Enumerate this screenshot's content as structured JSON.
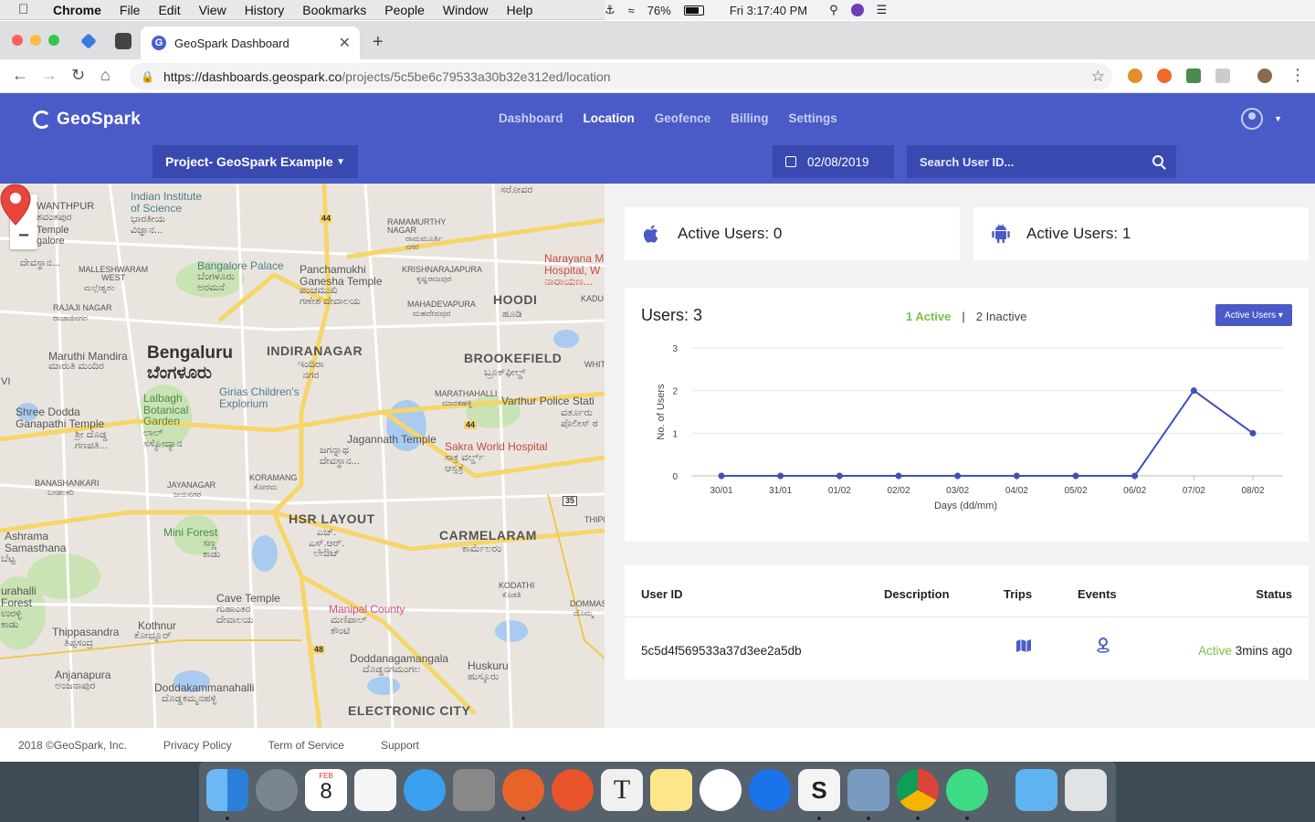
{
  "menubar": {
    "app": "Chrome",
    "items": [
      "File",
      "Edit",
      "View",
      "History",
      "Bookmarks",
      "People",
      "Window",
      "Help"
    ],
    "battery": "76%",
    "clock": "Fri 3:17:40 PM"
  },
  "browser": {
    "tab_title": "GeoSpark Dashboard",
    "url_host": "https://dashboards.geospark.co",
    "url_path": "/projects/5c5be6c79533a30b32e312ed/location"
  },
  "header": {
    "logo_text": "GeoSpark",
    "nav": [
      "Dashboard",
      "Location",
      "Geofence",
      "Billing",
      "Settings"
    ],
    "active_nav": "Location",
    "project_selector": "Project- GeoSpark Example",
    "date": "02/08/2019",
    "search_placeholder": "Search User ID..."
  },
  "map": {
    "labels": {
      "bengaluru": "Bengaluru",
      "bengaluru_kn": "ಬೆಂಗಳೂರು",
      "indiranagar": "INDIRANAGAR",
      "indiranagar_kn": "ಇಂದಿರಾ\nನಗರ",
      "brookefield": "BROOKEFIELD",
      "brookefield_kn": "ಬ್ರೂಕ್‌ಫೀಲ್ಡ್",
      "hoodi": "HOODI",
      "hoodi_kn": "ಹೂಡಿ",
      "hsr": "HSR LAYOUT",
      "hsr_kn": "ಎಚ್.\nಎಸ್.ಆರ್.\nಲೇಔಟ್",
      "carmelaram": "CARMELARAM",
      "carmelaram_kn": "ಕಾರ್ಮೆಲರಂ",
      "electronic_city": "ELECTRONIC CITY",
      "iisc": "Indian Institute\nof Science",
      "iisc_kn": "ಭಾರತೀಯ\nವಿಜ್ಞಾನ...",
      "palace": "Bangalore Palace",
      "palace_kn": "ಬೆಂಗಳೂರು\nಅರಮನೆ",
      "panchamukhi": "Panchamukhi\nGanesha Temple",
      "panchamukhi_kn": "ಪಂಚಮುಖಿ\nಗಣೇಶ ದೇವಾಲಯ",
      "ramamurthy": "RAMAMURTHY\nNAGAR",
      "ramamurthy_kn": "ರಾಮಮೂರ್ತಿ\nನಗರ",
      "krishnarajapura": "KRISHNARAJAPURA",
      "krishnarajapura_kn": "ಕೃಷ್ಣರಾಜಪುರ",
      "mahadevapura": "MAHADEVAPURA",
      "mahadevapura_kn": "ಮಹದೇವಪುರ",
      "narayana": "Narayana M\nHospital, W\nನಾರಾಯಣ...",
      "malleshwaram": "MALLESHWARAM\nWEST",
      "malleshwaram_kn": "ಮಲ್ಲೇಶ್ವರಂ",
      "rajaji": "RAJAJI NAGAR",
      "rajaji_kn": "ರಾಜಾಜಿನಗರ",
      "maruthi": "Maruthi Mandira",
      "maruthi_kn": "ಮಾರುತಿ ಮಂದಿರ",
      "girias": "Girias Children's\nExplorium",
      "lalbagh": "Lalbagh\nBotanical\nGarden",
      "lalbagh_kn": "ಲಾಲ್\nಸಸ್ಯೋದ್ಯಾನ",
      "shree": "Shree Dodda\nGanapathi Temple",
      "shree_kn": "ಶ್ರೀ ದೊಡ್ಡ\nಗಣಪತಿ...",
      "jagannath": "Jagannath Temple",
      "jagannath_kn": "ಜಗನ್ನಾಥ\nದೇವಸ್ಥಾನ...",
      "sakra": "Sakra World Hospital",
      "sakra_kn": "ಸಾಕ್ರ ವರ್ಲ್ಡ್\nಆಸ್ಪತ್ರೆ",
      "marathahalli": "MARATHAHALLI",
      "marathahalli_kn": "ಮಾರತಹಳ್ಳಿ",
      "varthur": "Varthur Police Stati",
      "varthur_kn": "ವರ್ತೂರು\nಪೊಲೀಸ್ ಠ",
      "banashankari": "BANASHANKARI",
      "banashankari_kn": "ಬನಶಂಕರಿ",
      "jayanagar": "JAYANAGAR",
      "jayanagar_kn": "ಜಯನಗರ",
      "koramangala": "KORAMANG",
      "koramangala_kn": "ಕೋರಮ",
      "mini_forest": "Mini Forest",
      "mini_forest_kn": "ಸಣ್ಣ\nಕಾಡು",
      "ashrama": "Ashrama\nSamasthana",
      "ashrama_kn": "ಬೆಟ್ಟ",
      "cave": "Cave Temple",
      "cave_kn": "ಗುಹಾಂತರ\nದೇವಾಲಯ",
      "kodathi": "KODATHI",
      "kodathi_kn": "ಕೊಡತಿ",
      "dommas": "DOMMAS",
      "dommas_kn": "ದೊಮ್ಮ",
      "manipal": "Manipal County",
      "manipal_kn": "ಮಣಿಪಾಲ್\nಕೌಂಟಿ",
      "kothnur": "Kothnur",
      "kothnur_kn": "ಕೋಥ್ನೂರ್",
      "thippasandra": "Thippasandra",
      "thippasandra_kn": "ತಿಪ್ಪಸಂದ್ರ",
      "uralli": "urahalli\nForest",
      "uralli_kn": "ಉರಳ್ಳಿ\nಕಾಡು",
      "anjanapura": "Anjanapura",
      "anjanapura_kn": "ಅಂಜನಾಪುರ",
      "doddakamman": "Doddakammanahalli",
      "doddakamman_kn": "ದೊಡ್ಡಕಮ್ಮನಹಳ್ಳಿ",
      "doddanaga": "Doddanagamangala",
      "doddanaga_kn": "ದೊಡ್ಡನಗಮಂಗಲ",
      "huskuru": "Huskuru",
      "huskuru_kn": "ಹುಸ್ಕೂರು",
      "thip": "THIPP",
      "kadu": "KADU",
      "whit": "WHIT",
      "hwy44a": "44",
      "hwy44b": "44",
      "hwy48": "48",
      "hwy35": "35",
      "temple_top": "Temple",
      "temple_top_kn": "galore",
      "wanthpur": "WANTHPUR",
      "wanthpur_kn": "ಶವಂತಪುರ",
      "devasth": "ದೇವಸ್ಥಾನ...",
      "vi": "VI",
      "top_kn": "ಸರೋವರ"
    },
    "zoom_in": "+",
    "zoom_out": "−"
  },
  "stats": {
    "ios_label": "Active Users: 0",
    "android_label": "Active Users: 1"
  },
  "chart_card": {
    "title": "Users: 3",
    "active_legend": "1 Active",
    "separator": "|",
    "inactive_legend": "2 Inactive",
    "dropdown_label": "Active Users ▾"
  },
  "chart_data": {
    "type": "line",
    "categories": [
      "30/01",
      "31/01",
      "01/02",
      "02/02",
      "03/02",
      "04/02",
      "05/02",
      "06/02",
      "07/02",
      "08/02"
    ],
    "values": [
      0,
      0,
      0,
      0,
      0,
      0,
      0,
      0,
      2,
      1
    ],
    "xlabel": "Days (dd/mm)",
    "ylabel": "No. of Users",
    "ylim": [
      0,
      3
    ],
    "yticks": [
      0,
      1,
      2,
      3
    ],
    "grid": true,
    "color": "#3f51b5"
  },
  "table": {
    "headers": {
      "user_id": "User ID",
      "description": "Description",
      "trips": "Trips",
      "events": "Events",
      "status": "Status"
    },
    "rows": [
      {
        "user_id": "5c5d4f569533a37d3ee2a5db",
        "status_word": "Active",
        "status_time": "3mins ago"
      }
    ]
  },
  "footer": {
    "copyright": "2018 ©GeoSpark, Inc.",
    "links": [
      "Privacy Policy",
      "Term of Service",
      "Support"
    ]
  },
  "dock": {
    "calendar_month": "FEB",
    "calendar_day": "8",
    "text_app": "T",
    "s_app": "S"
  }
}
